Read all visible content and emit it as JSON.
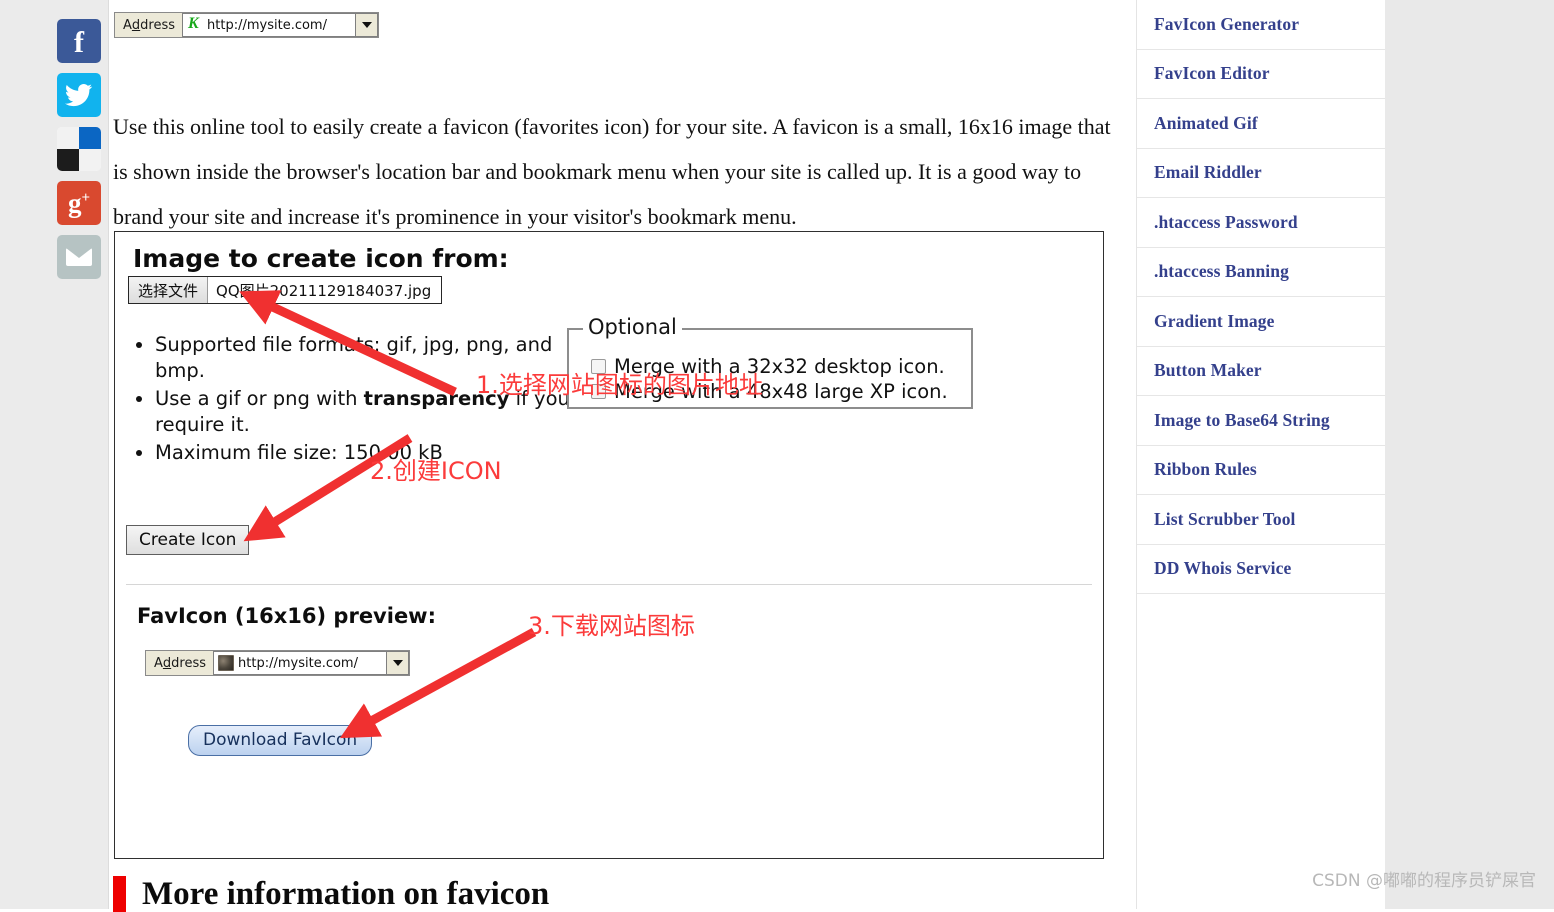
{
  "social": {
    "items": [
      {
        "name": "facebook",
        "glyph": "f",
        "color": "#3b5998"
      },
      {
        "name": "twitter",
        "glyph": "✆",
        "color": "#11b3ee"
      },
      {
        "name": "delicious",
        "glyph": "",
        "color": "#0b66c3"
      },
      {
        "name": "googleplus",
        "glyph": "g",
        "plus": "+",
        "color": "#d9492f"
      },
      {
        "name": "email",
        "glyph": "",
        "color": "#b6c3c3"
      }
    ]
  },
  "topbar": {
    "address_label": "Address",
    "address_value": "http://mysite.com/"
  },
  "intro": {
    "paragraph": "Use this online tool to easily create a favicon (favorites icon) for your site. A favicon is a small, 16x16 image that is shown inside the browser's location bar and bookmark menu when your site is called up. It is a good way to brand your site and increase it's prominence in your visitor's bookmark menu."
  },
  "panel": {
    "title": "Image to create icon from:",
    "file_button_label": "选择文件",
    "file_name": "QQ图片20211129184037.jpg",
    "bullets": [
      {
        "pre": "Supported file formats: gif, jpg, png, and bmp.",
        "bold": "",
        "post": ""
      },
      {
        "pre": "Use a gif or png with ",
        "bold": "transparency",
        "post": " if you require it."
      },
      {
        "pre": "Maximum file size: 150.00 kB",
        "bold": "",
        "post": ""
      }
    ],
    "optional": {
      "legend": "Optional",
      "options": [
        "Merge with a 32x32 desktop icon.",
        "Merge with a 48x48 large XP icon."
      ]
    },
    "create_button_label": "Create Icon",
    "preview_title": "FavIcon (16x16) preview:",
    "preview_address_label": "Address",
    "preview_address_value": "http://mysite.com/",
    "download_button_label": "Download FavIcon"
  },
  "bottom_heading": "More information on favicon",
  "sidebar": {
    "items": [
      {
        "label": "FavIcon Generator"
      },
      {
        "label": "FavIcon Editor"
      },
      {
        "label": "Animated Gif"
      },
      {
        "label": "Email Riddler"
      },
      {
        "label": ".htaccess Password"
      },
      {
        "label": ".htaccess Banning"
      },
      {
        "label": "Gradient Image"
      },
      {
        "label": "Button Maker"
      },
      {
        "label": "Image to Base64 String"
      },
      {
        "label": "Ribbon Rules"
      },
      {
        "label": "List Scrubber Tool"
      },
      {
        "label": "DD Whois Service"
      }
    ]
  },
  "annotations": {
    "step1": "1.选择网站图标的图片地址",
    "step2": "2.创建ICON",
    "step3": "3.下载网站图标",
    "color": "#fb3b3b"
  },
  "watermark": "CSDN @嘟嘟的程序员铲屎官"
}
